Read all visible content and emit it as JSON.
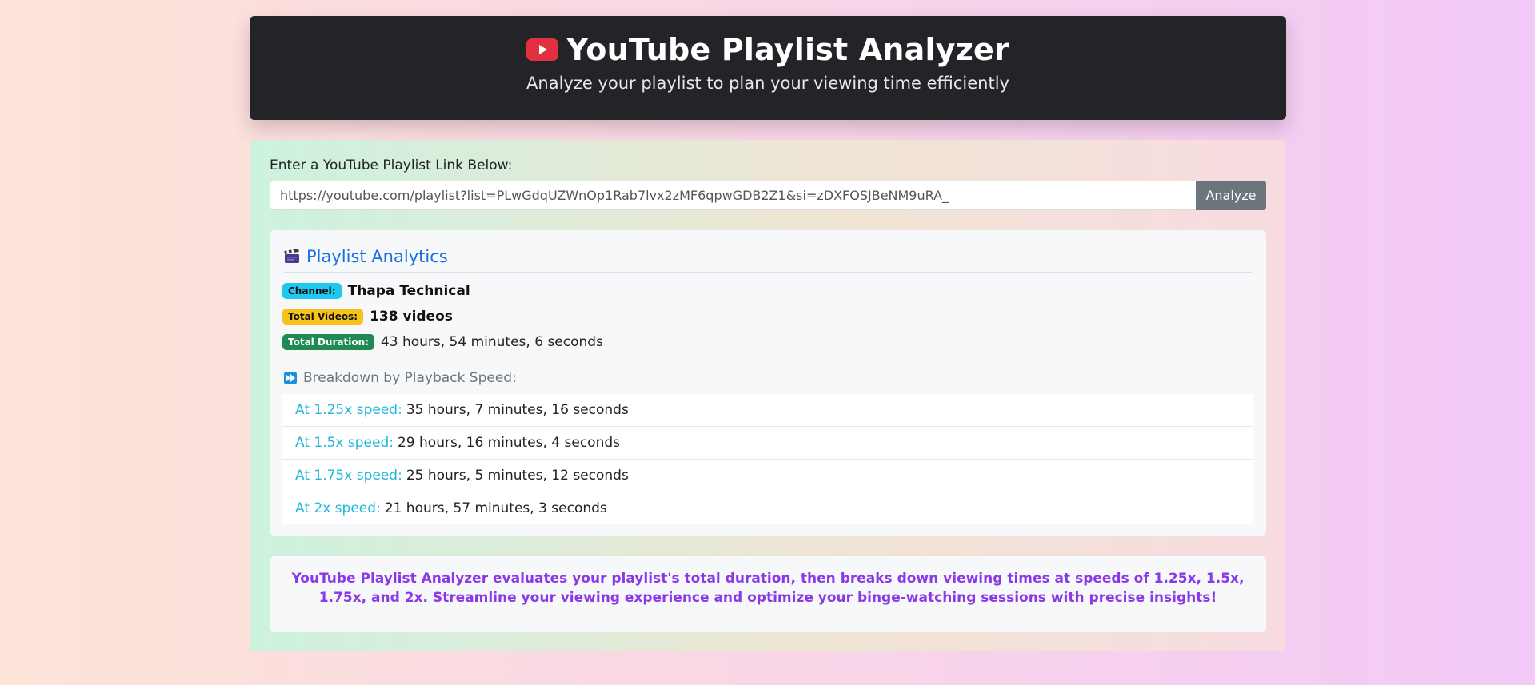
{
  "header": {
    "title": "YouTube Playlist Analyzer",
    "subtitle": "Analyze your playlist to plan your viewing time efficiently"
  },
  "form": {
    "label": "Enter a YouTube Playlist Link Below:",
    "url_value": "https://youtube.com/playlist?list=PLwGdqUZWnOp1Rab7lvx2zMF6qpwGDB2Z1&si=zDXFOSJBeNM9uRA_",
    "button_label": "Analyze"
  },
  "analytics": {
    "title": "Playlist Analytics",
    "channel": {
      "badge": "Channel:",
      "value": "Thapa Technical"
    },
    "videos": {
      "badge": "Total Videos:",
      "value": "138 videos"
    },
    "duration": {
      "badge": "Total Duration:",
      "value": "43 hours, 54 minutes, 6 seconds"
    },
    "breakdown_heading": "Breakdown by Playback Speed:",
    "speeds": [
      {
        "label": "At 1.25x speed:",
        "value": "35 hours, 7 minutes, 16 seconds"
      },
      {
        "label": "At 1.5x speed:",
        "value": "29 hours, 16 minutes, 4 seconds"
      },
      {
        "label": "At 1.75x speed:",
        "value": "25 hours, 5 minutes, 12 seconds"
      },
      {
        "label": "At 2x speed:",
        "value": "21 hours, 57 minutes, 3 seconds"
      }
    ]
  },
  "info": {
    "text": "YouTube Playlist Analyzer evaluates your playlist's total duration, then breaks down viewing times at speeds of 1.25x, 1.5x, 1.75x, and 2x. Streamline your viewing experience and optimize your binge-watching sessions with precise insights!"
  },
  "icons": {
    "header": "youtube-icon",
    "analytics": "clapper-board-icon",
    "breakdown": "fast-forward-icon"
  },
  "colors": {
    "header_bg": "#222428",
    "youtube_red": "#e33040",
    "accent_blue": "#1a6fe0",
    "speed_label": "#21b8dc",
    "info_text": "#8a38e8"
  }
}
